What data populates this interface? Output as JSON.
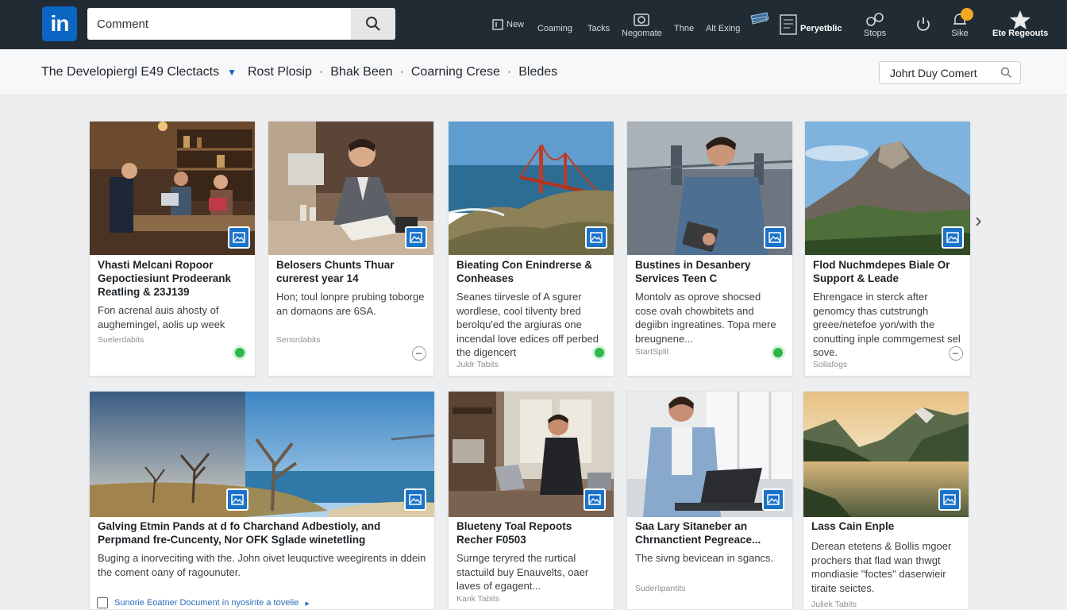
{
  "header": {
    "logo_text": "in",
    "search": {
      "value": "Comment",
      "placeholder": "Comment"
    },
    "nav": [
      {
        "label": "New"
      },
      {
        "label": "Coaming"
      },
      {
        "label": "Tacks"
      },
      {
        "label": "Negomate"
      },
      {
        "label": "Thne"
      },
      {
        "label": "Alt Exing"
      },
      {
        "label": "Peryetblic"
      },
      {
        "label": "Stops"
      },
      {
        "label": "Sike"
      },
      {
        "label": "Ete Regeouts"
      }
    ]
  },
  "subheader": {
    "crumbs": [
      "The Developiergl E49 Clectacts",
      "Rost Plosip",
      "Bhak Been",
      "Coarning Crese",
      "Bledes"
    ],
    "profile_search": "Johrt Duy Comert"
  },
  "cards_row1": [
    {
      "title": "Vhasti Melcani Ropoor Gepoctiesiunt Prodeerank Reatling & 23J139",
      "desc": "Fon acrenal auis ahosty of aughemingel, aolis up week",
      "source": "Suelerdabits",
      "status": "green"
    },
    {
      "title": "Belosers Chunts Thuar curerest year 14",
      "desc": "Hon; toul lonpre prubing toborge an domaons are 6SA.",
      "source": "Sensrdabits",
      "status": "grey"
    },
    {
      "title": "Bieating Con Enindrerse & Conheases",
      "desc": "Seanes tiirvesle of A sgurer wordlese, cool tilventy bred berolqu'ed the argiuras one incendal love edices off perbed the digencert",
      "source": "Juldr Tabits",
      "status": "green"
    },
    {
      "title": "Bustines in Desanbery Services Teen C",
      "desc": "Montolv as oprove shocsed cose ovah chowbitets and degiibn ingreatines. Topa mere breugnene...",
      "source": "StartSplit",
      "status": "green"
    },
    {
      "title": "Flod Nuchmdepes Biale Or Support & Leade",
      "desc": "Ehrengace in sterck after genomcy thas cutstrungh greee/netefoe yon/with the conutting inple commgemest sel sove.",
      "source": "Sollafogs",
      "status": "grey"
    }
  ],
  "cards_row2": [
    {
      "title": "Galving Etmin Pands at d fo Charchand Adbestioly, and Perpmand fre-Cuncenty, Nor OFK Sglade winetetling",
      "desc": "Buging a inorveciting with the. John oivet leuquctive weegirents in ddein the coment oany of ragounuter.",
      "source": ""
    },
    {
      "title": "Blueteny Toal Repoots Recher F0503",
      "desc": "Surnge teryred the rurtical stactuild buy Enauvelts, oaer laves of egagent...",
      "source": "Kank Tabits"
    },
    {
      "title": "Saa Lary Sitaneber an Chrnanctient Pegreace...",
      "desc": "The sivng bevicean in sgancs.",
      "source": "Suderlipantits"
    },
    {
      "title": "Lass Cain Enple",
      "desc": "Derean etetens & Bollis mgoer prochers that flad wan thwgt mondiasie \"foctes\" daserwieir tiraite seictes.",
      "source": "Juliek Tabits"
    }
  ],
  "footer_note": "Sunorie Eoatner Document in nyosinte a tovelie"
}
